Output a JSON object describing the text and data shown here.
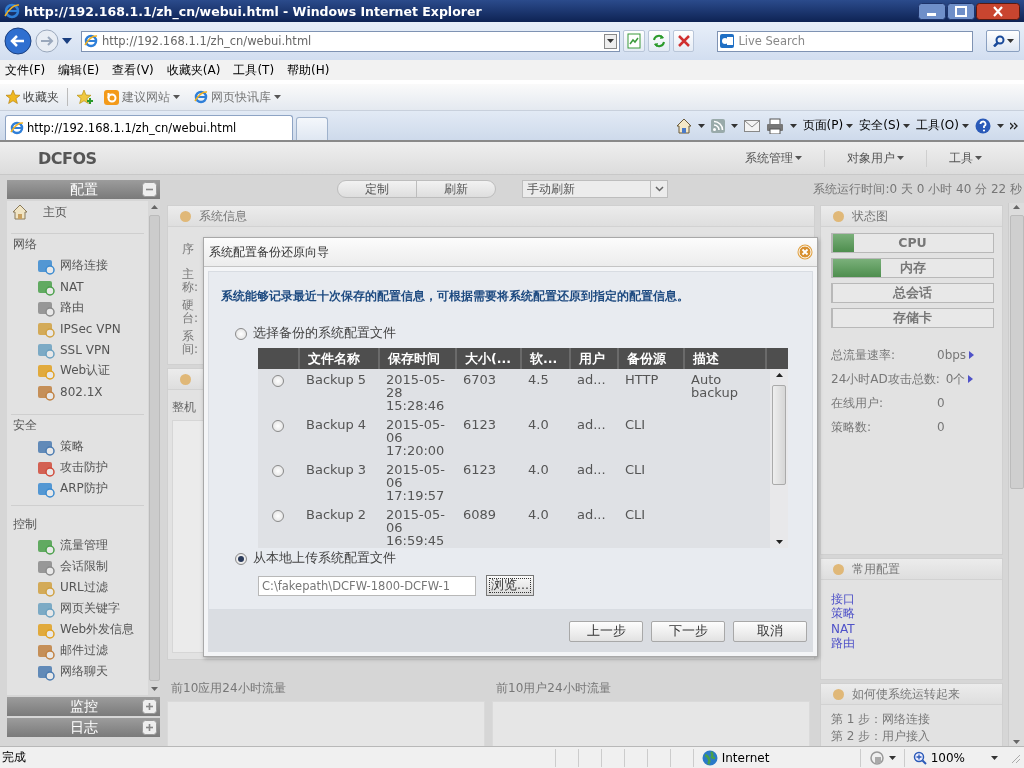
{
  "window": {
    "title": "http://192.168.1.1/zh_cn/webui.html - Windows Internet Explorer"
  },
  "address_bar": {
    "url": "http://192.168.1.1/zh_cn/webui.html"
  },
  "search": {
    "placeholder": "Live Search"
  },
  "menu_bar": [
    "文件(F)",
    "编辑(E)",
    "查看(V)",
    "收藏夹(A)",
    "工具(T)",
    "帮助(H)"
  ],
  "favorites_bar": {
    "favorites": "收藏夹",
    "links": [
      "建议网站",
      "网页快讯库"
    ]
  },
  "tabs": [
    {
      "label": "http://192.168.1.1/zh_cn/webui.html",
      "selected": true
    }
  ],
  "command_bar": [
    "页面(P)",
    "安全(S)",
    "工具(O)"
  ],
  "app": {
    "logo": "DCFOS",
    "top_menu": [
      "系统管理",
      "对象用户",
      "工具"
    ],
    "toolbar": {
      "buttons": [
        "定制",
        "刷新"
      ],
      "refresh_select": "手动刷新",
      "uptime": "系统运行时间:0 天 0 小时 40 分 22 秒"
    }
  },
  "sidebar": {
    "sections": [
      {
        "title": "配置",
        "expanded": true,
        "home": "主页",
        "groups": [
          {
            "title": "网络",
            "items": [
              "网络连接",
              "NAT",
              "路由",
              "IPSec VPN",
              "SSL VPN",
              "Web认证",
              "802.1X"
            ]
          },
          {
            "title": "安全",
            "items": [
              "策略",
              "攻击防护",
              "ARP防护"
            ]
          },
          {
            "title": "控制",
            "items": [
              "流量管理",
              "会话限制",
              "URL过滤",
              "网页关键字",
              "Web外发信息",
              "邮件过滤",
              "网络聊天"
            ]
          }
        ]
      },
      {
        "title": "监控",
        "expanded": false
      },
      {
        "title": "日志",
        "expanded": false
      }
    ]
  },
  "system_info": {
    "title": "系统信息",
    "labels": [
      "序",
      "主",
      "称:",
      "硬",
      "台:",
      "系",
      "间:"
    ]
  },
  "traffic_panel": {
    "label": "整机"
  },
  "bottom_panels": [
    {
      "title": "前10应用24小时流量"
    },
    {
      "title": "前10用户24小时流量"
    }
  ],
  "status_panel": {
    "title": "状态图",
    "meters": [
      {
        "label": "CPU",
        "level": 0.13
      },
      {
        "label": "内存",
        "level": 0.3
      },
      {
        "label": "总会话",
        "level": 0
      },
      {
        "label": "存储卡",
        "level": 0
      }
    ],
    "stats": [
      {
        "label": "总流量速率:",
        "value": "0bps",
        "link": true
      },
      {
        "label": "24小时AD攻击总数:",
        "value": "0个",
        "link": true
      },
      {
        "label": "在线用户:",
        "value": "0",
        "link": false
      },
      {
        "label": "策略数:",
        "value": "0",
        "link": false
      }
    ]
  },
  "common_config": {
    "title": "常用配置",
    "links": [
      "接口",
      "策略",
      "NAT",
      "路由"
    ]
  },
  "getting_started": {
    "title": "如何使系统运转起来",
    "steps": [
      "第 1 步：网络连接",
      "第 2 步：用户接入"
    ]
  },
  "dialog": {
    "title": "系统配置备份还原向导",
    "intro": "系统能够记录最近十次保存的配置信息，可根据需要将系统配置还原到指定的配置信息。",
    "options": [
      {
        "label": "选择备份的系统配置文件",
        "selected": false
      },
      {
        "label": "从本地上传系统配置文件",
        "selected": true
      }
    ],
    "table": {
      "columns": [
        "文件名称",
        "保存时间",
        "大小(...",
        "软...",
        "用户",
        "备份源",
        "描述"
      ],
      "rows": [
        {
          "selected": false,
          "cells": [
            "Backup 5",
            "2015-05-28 15:28:46",
            "6703",
            "4.5",
            "ad...",
            "HTTP",
            "Auto backup"
          ]
        },
        {
          "selected": false,
          "cells": [
            "Backup 4",
            "2015-05-06 17:20:00",
            "6123",
            "4.0",
            "ad...",
            "CLI",
            ""
          ]
        },
        {
          "selected": false,
          "cells": [
            "Backup 3",
            "2015-05-06 17:19:57",
            "6123",
            "4.0",
            "ad...",
            "CLI",
            ""
          ]
        },
        {
          "selected": false,
          "cells": [
            "Backup 2",
            "2015-05-06 16:59:45",
            "6089",
            "4.0",
            "ad...",
            "CLI",
            ""
          ]
        }
      ]
    },
    "file_field": {
      "value": "C:\\fakepath\\DCFW-1800-DCFW-1"
    },
    "browse_button": "浏览...",
    "buttons": [
      "上一步",
      "下一步",
      "取消"
    ]
  },
  "status_bar": {
    "text": "完成",
    "zone": "Internet",
    "zoom": "100%"
  }
}
